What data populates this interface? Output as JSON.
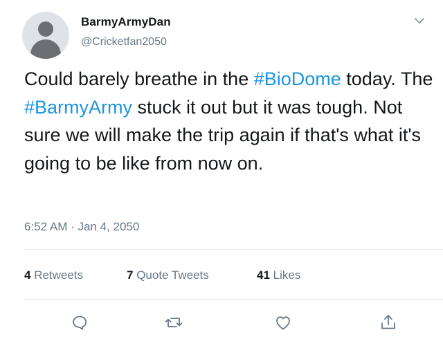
{
  "user": {
    "display_name": "BarmyArmyDan",
    "handle": "@Cricketfan2050"
  },
  "tweet": {
    "text_parts": [
      "Could barely breathe in the ",
      "#BioDome",
      " today. The ",
      "#BarmyArmy",
      " stuck it out but it was tough. Not sure we will make the trip again if that's what it's going to be like from now on."
    ],
    "timestamp": "6:52 AM · Jan 4, 2050"
  },
  "stats": {
    "retweets": {
      "count": "4",
      "label": "Retweets"
    },
    "quote_tweets": {
      "count": "7",
      "label": "Quote Tweets"
    },
    "likes": {
      "count": "41",
      "label": "Likes"
    }
  },
  "colors": {
    "hashtag": "#1b95e0",
    "secondary_text": "#657786",
    "primary_text": "#14171a",
    "divider": "#e6ecf0"
  },
  "icons": {
    "menu": "chevron-down-icon",
    "reply": "reply-icon",
    "retweet": "retweet-icon",
    "like": "heart-icon",
    "share": "share-icon"
  }
}
